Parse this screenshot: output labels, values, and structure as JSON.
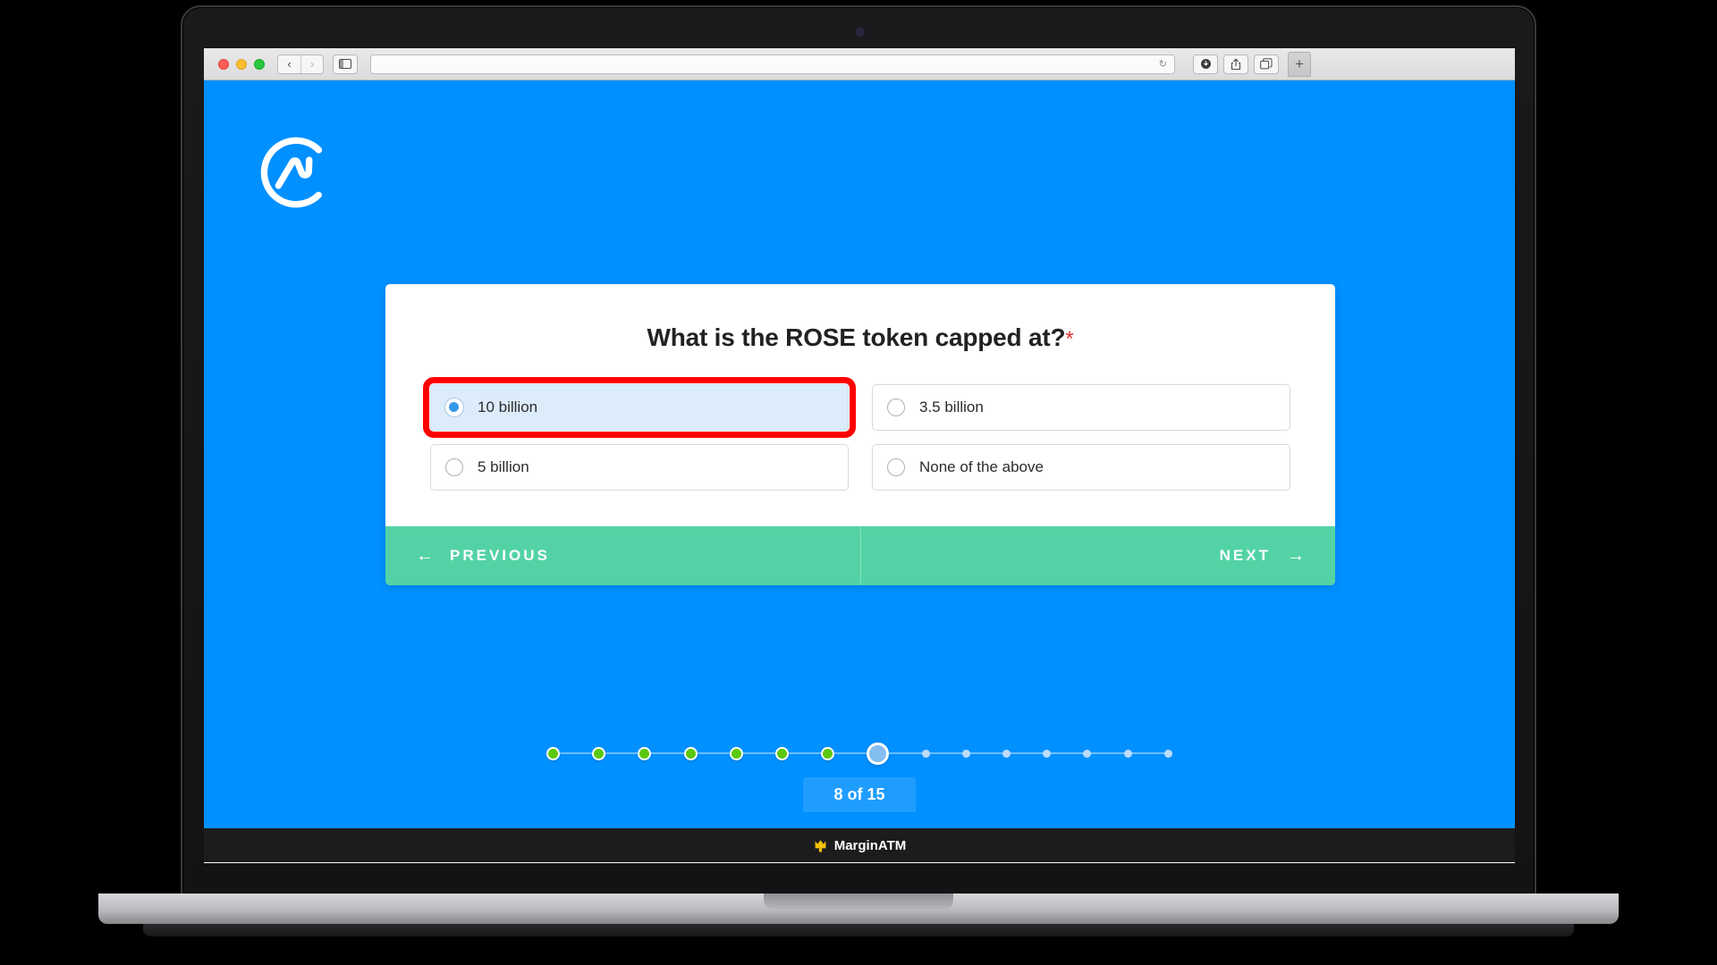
{
  "browser": {
    "traffic_lights": [
      "close",
      "minimize",
      "maximize"
    ],
    "back_label": "‹",
    "forward_label": "›",
    "sidebar_icon": "sidebar-icon",
    "address_value": "",
    "address_placeholder": "",
    "reload_glyph": "↻",
    "downloads_glyph": "↓",
    "share_glyph": "↑",
    "tabs_glyph": "⧉",
    "new_tab_label": "+"
  },
  "page": {
    "brand_logo": "coinmarketcap-logo",
    "background_color": "#0090ff"
  },
  "quiz": {
    "question": "What is the ROSE token capped at?",
    "required_marker": "*",
    "options": [
      {
        "label": "10 billion",
        "selected": true,
        "highlighted": true
      },
      {
        "label": "3.5 billion",
        "selected": false,
        "highlighted": false
      },
      {
        "label": "5 billion",
        "selected": false,
        "highlighted": false
      },
      {
        "label": "None of the above",
        "selected": false,
        "highlighted": false
      }
    ],
    "previous_label": "PREVIOUS",
    "next_label": "NEXT",
    "previous_arrow": "←",
    "next_arrow": "→",
    "footer_color": "#53d3a5",
    "selected_row_color": "#dcecfb",
    "highlight_color": "#ff0000"
  },
  "progress": {
    "label": "8 of 15",
    "current": 8,
    "total": 15,
    "done_color": "#5cc80f",
    "current_color": "#84bdf0",
    "todo_color": "#bcdcf7",
    "steps": [
      "done",
      "done",
      "done",
      "done",
      "done",
      "done",
      "done",
      "current",
      "todo",
      "todo",
      "todo",
      "todo",
      "todo",
      "todo",
      "todo"
    ]
  },
  "watermark": {
    "text": "MarginATM",
    "icon": "crown-icon",
    "icon_color": "#f4c20d"
  }
}
